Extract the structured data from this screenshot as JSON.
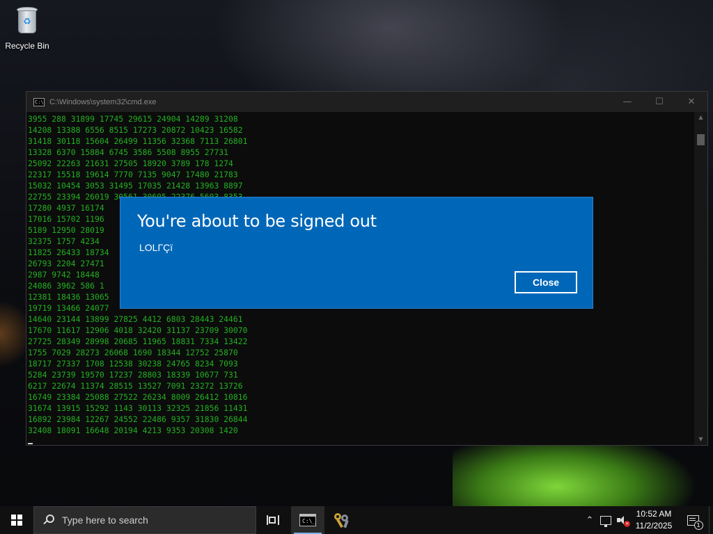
{
  "desktop": {
    "icons": [
      {
        "label": "Recycle Bin",
        "icon": "recycle-bin-icon"
      }
    ]
  },
  "cmd_window": {
    "title": "C:\\Windows\\system32\\cmd.exe",
    "text_color": "#23b022",
    "lines": [
      "3955 288 31899 17745 29615 24904 14289 31208",
      "14208 13388 6556 8515 17273 20872 10423 16582",
      "31418 30118 15604 26499 11356 32368 7113 26801",
      "13328 6370 15884 6745 3586 5508 8955 27731",
      "25092 22263 21631 27505 18920 3789 178 1274",
      "22317 15518 19614 7770 7135 9047 17480 21783",
      "15032 10454 3053 31495 17035 21428 13963 8897",
      "22755 23394 26019 30561 30605 22376 5603 8353",
      "17280 4937 16174",
      "17016 15702 1196",
      "5189 12950 28019",
      "32375 1757 4234",
      "11825 26433 18734",
      "26793 2204 27471",
      "2987 9742 18448",
      "24086 3962 586 1",
      "12381 18436 13065",
      "19719 13466 24077",
      "14640 23144 13899 27825 4412 6803 28443 24461",
      "17670 11617 12906 4018 32420 31137 23709 30070",
      "27725 28349 28998 20685 11965 18831 7334 13422",
      "1755 7029 28273 26068 1690 18344 12752 25870",
      "18717 27337 1708 12538 30238 24765 8234 7093",
      "5284 23739 19570 17237 28803 18339 10677 731",
      "6217 22674 11374 28515 13527 7091 23272 13726",
      "16749 23384 25088 27522 26234 8009 26412 10816",
      "31674 13915 15292 1143 30113 32325 21856 11431",
      "16892 23984 12267 24552 22486 9357 31830 26844",
      "32408 18091 16648 20194 4213 9353 20308 1420"
    ]
  },
  "dialog": {
    "title": "You're about to be signed out",
    "message": "LOLΓÇï",
    "close_label": "Close",
    "background_color": "#0067b8"
  },
  "taskbar": {
    "search_placeholder": "Type here to search",
    "time": "10:52 AM",
    "date": "11/2/2025",
    "notification_count": "1",
    "apps": [
      {
        "name": "task-view",
        "icon": "task-view-icon"
      },
      {
        "name": "cmd",
        "icon": "cmd-icon",
        "active": true
      },
      {
        "name": "credentials",
        "icon": "keys-icon"
      }
    ]
  }
}
